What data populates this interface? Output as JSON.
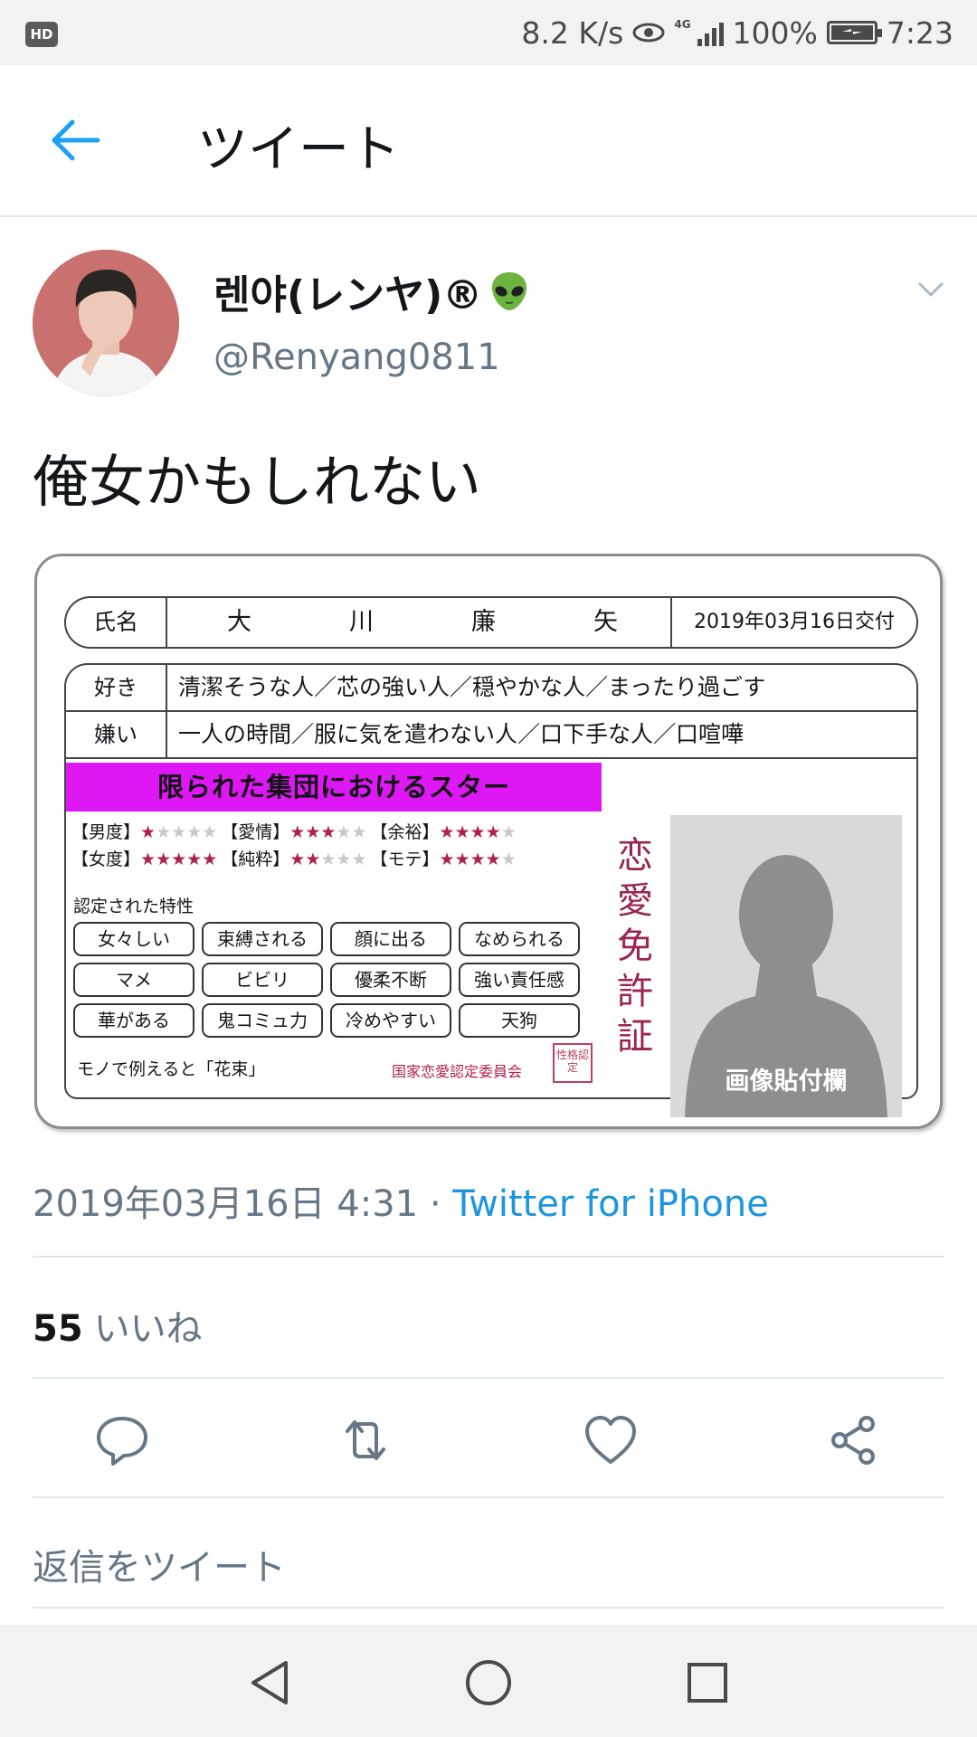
{
  "status_bar": {
    "badge": "HD",
    "speed": "8.2 K/s",
    "network": "4G",
    "battery": "100%",
    "time": "7:23"
  },
  "header": {
    "title": "ツイート"
  },
  "tweet": {
    "display_name": "렌야(レンヤ)®",
    "handle": "@Renyang0811",
    "text": "俺女かもしれない",
    "date": "2019年03月16日 4:31",
    "separator": "·",
    "source": "Twitter for iPhone",
    "likes_count": "55",
    "likes_label": "いいね",
    "reply_placeholder": "返信をツイート"
  },
  "license": {
    "name_label": "氏名",
    "name_chars": [
      "大",
      "川",
      "廉",
      "矢"
    ],
    "issue_date": "2019年03月16日交付",
    "likes_label": "好き",
    "likes_value": "清潔そうな人／芯の強い人／穏やかな人／まったり過ごす",
    "dislikes_label": "嫌い",
    "dislikes_value": "一人の時間／服に気を遣わない人／口下手な人／口喧嘩",
    "banner": "限られた集団におけるスター",
    "ratings_row1": [
      {
        "label": "【男度】",
        "stars": 1
      },
      {
        "label": "【愛情】",
        "stars": 3
      },
      {
        "label": "【余裕】",
        "stars": 4
      }
    ],
    "ratings_row2": [
      {
        "label": "【女度】",
        "stars": 5
      },
      {
        "label": "【純粋】",
        "stars": 2
      },
      {
        "label": "【モテ】",
        "stars": 4
      }
    ],
    "traits_label": "認定された特性",
    "traits": [
      "女々しい",
      "束縛される",
      "顔に出る",
      "なめられる",
      "マメ",
      "ビビリ",
      "優柔不断",
      "強い責任感",
      "華がある",
      "鬼コミュ力",
      "冷めやすい",
      "天狗"
    ],
    "mono": "モノで例えると「花束」",
    "committee": "国家恋愛認定委員会",
    "seal": "性格認定",
    "vertical_title": [
      "恋",
      "愛",
      "免",
      "許",
      "証"
    ],
    "photo_label": "画像貼付欄"
  },
  "colors": {
    "link": "#1b95e0",
    "icon": "#657786",
    "banner": "#dd18f5",
    "star": "#b0204e"
  }
}
